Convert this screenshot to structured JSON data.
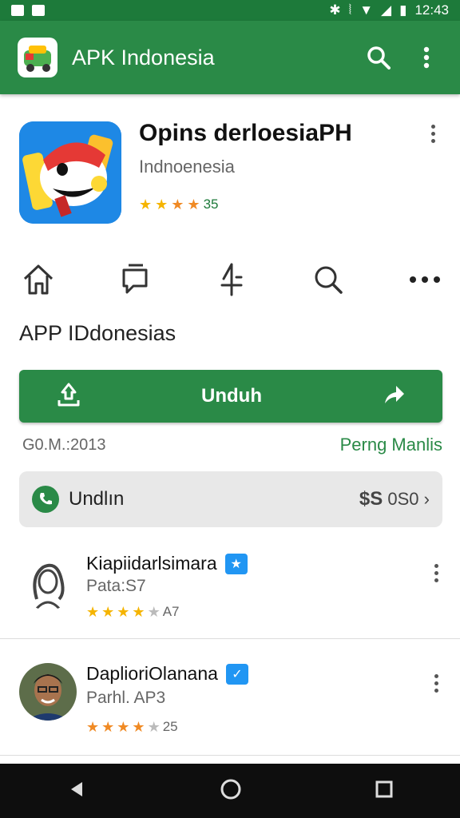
{
  "status": {
    "time": "12:43"
  },
  "appbar": {
    "title": "APK Indonesia",
    "search_icon": "search-icon",
    "menu_icon": "more-vert-icon"
  },
  "app": {
    "name": "Opins derloesiaPH",
    "developer": "Indnoenesia",
    "rating": "35",
    "stars": 4
  },
  "actions": [
    "home",
    "chat",
    "share",
    "search",
    "more"
  ],
  "section_title": "APP IDdonesias",
  "download": {
    "label": "Unduh"
  },
  "meta": {
    "left": "G0.M.:2013",
    "right": "Perng Manlis"
  },
  "price_row": {
    "label": "Undlın",
    "currency": "$S",
    "value": "0S0"
  },
  "reviews": [
    {
      "name": "Kiapiidarlsimara",
      "sub": "Pata:S7",
      "score": "A7",
      "stars": 4
    },
    {
      "name": "DaplioriOlanana",
      "sub": "Parhl. AP3",
      "score": "25",
      "stars": 4
    }
  ],
  "colors": {
    "primary": "#2a8a47",
    "status": "#1d7a3a",
    "star_gold": "#f5b400",
    "star_orange": "#f08a24"
  }
}
